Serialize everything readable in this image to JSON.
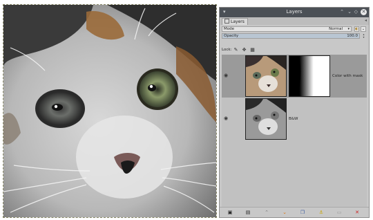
{
  "dock": {
    "title": "Layers",
    "tab_label": "Layers",
    "mode_label": "Mode",
    "mode_value": "Normal",
    "opacity_label": "Opacity",
    "opacity_value": "100.0",
    "opacity_fraction": 1.0,
    "lock_label": "Lock:"
  },
  "layers": [
    {
      "name": "Color with mask",
      "visible": true,
      "selected": true,
      "has_mask": true
    },
    {
      "name": "B&W",
      "visible": true,
      "selected": false,
      "has_mask": false
    }
  ],
  "icons": {
    "titlebar_left": "pin-icon",
    "titlebar_right": [
      "maximize-icon",
      "minimize-icon",
      "close-icon"
    ],
    "lock": [
      "paint-brush-icon",
      "move-icon",
      "alpha-lock-icon"
    ],
    "bottom": [
      "new-layer-icon",
      "new-layer-group-icon",
      "raise-layer-icon",
      "lower-layer-icon",
      "duplicate-layer-icon",
      "anchor-layer-icon",
      "merge-down-icon",
      "delete-layer-icon"
    ]
  },
  "colors": {
    "titlebar": "#4b5056",
    "panel": "#c8c8c8",
    "selected_layer": "#9a9a9a",
    "delete": "#cc2222",
    "lower_arrow": "#e07000"
  }
}
